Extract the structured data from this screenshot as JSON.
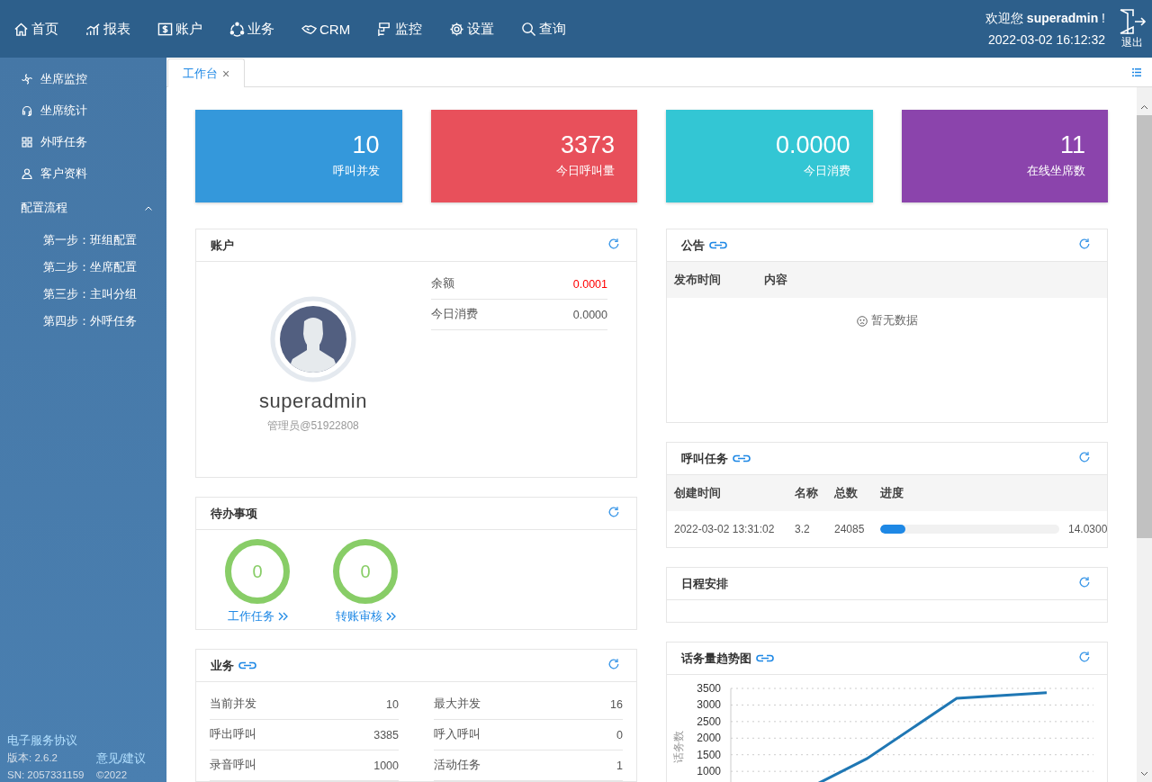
{
  "header": {
    "nav": [
      {
        "label": "首页"
      },
      {
        "label": "报表"
      },
      {
        "label": "账户"
      },
      {
        "label": "业务"
      },
      {
        "label": "CRM"
      },
      {
        "label": "监控"
      },
      {
        "label": "设置"
      },
      {
        "label": "查询"
      }
    ],
    "welcome": "欢迎您 **superadmin** !",
    "datetime": "2022-03-02 16:12:32",
    "logout": "退出"
  },
  "sidebar": {
    "items": [
      {
        "label": "坐席监控"
      },
      {
        "label": "坐席统计"
      },
      {
        "label": "外呼任务"
      },
      {
        "label": "客户资料"
      },
      {
        "label": "配置流程",
        "expanded": true,
        "children": [
          {
            "label": "第一步：班组配置"
          },
          {
            "label": "第二步：坐席配置"
          },
          {
            "label": "第三步：主叫分组"
          },
          {
            "label": "第四步：外呼任务"
          }
        ]
      }
    ],
    "footer": {
      "agreement_link": "电子服务协议",
      "version": "版本: 2.6.2",
      "feedback_link": "意见/建议",
      "sn": "SN: 2057331159",
      "copyright": "©2022"
    }
  },
  "tabs": [
    {
      "label": "工作台",
      "selected": true,
      "close": "×"
    }
  ],
  "stats": [
    {
      "value": "10",
      "label": "呼叫并发",
      "color": "#3498db"
    },
    {
      "value": "3373",
      "label": "今日呼叫量",
      "color": "#e8505b"
    },
    {
      "value": "0.0000",
      "label": "今日消费",
      "color": "#33c6d4"
    },
    {
      "value": "11",
      "label": "在线坐席数",
      "color": "#8b44ac"
    }
  ],
  "account": {
    "title": "账户",
    "linked": false,
    "name": "superadmin",
    "role": "管理员@51922808",
    "rows": [
      {
        "label": "余额",
        "value": "0.0001",
        "alert": true
      },
      {
        "label": "今日消费",
        "value": "0.0000",
        "alert": false
      }
    ]
  },
  "todo": {
    "title": "待办事项",
    "linked": false,
    "items": [
      {
        "count": "0",
        "label": "工作任务"
      },
      {
        "count": "0",
        "label": "转账审核"
      }
    ]
  },
  "business": {
    "title": "业务",
    "linked": true,
    "rows": [
      {
        "label": "当前并发",
        "value": "10"
      },
      {
        "label": "最大并发",
        "value": "16"
      },
      {
        "label": "呼出呼叫",
        "value": "3385"
      },
      {
        "label": "呼入呼叫",
        "value": "0"
      },
      {
        "label": "录音呼叫",
        "value": "1000"
      },
      {
        "label": "活动任务",
        "value": "1"
      }
    ]
  },
  "notice": {
    "title": "公告",
    "linked": true,
    "columns": [
      "发布时间",
      "内容"
    ],
    "empty": "暂无数据"
  },
  "tasks": {
    "title": "呼叫任务",
    "linked": true,
    "columns": [
      "创建时间",
      "名称",
      "总数",
      "进度"
    ],
    "rows": [
      {
        "created": "2022-03-02 13:31:02",
        "name": "3.2",
        "total": "24085",
        "level": 0.14,
        "percent": "14.0300"
      }
    ]
  },
  "schedule": {
    "title": "日程安排",
    "linked": false
  },
  "trend": {
    "title": "话务量趋势图",
    "linked": true,
    "chart_data": {
      "type": "line",
      "ylabel": "话务数",
      "ylim": [
        0,
        3500
      ],
      "yticks": [
        1000,
        1500,
        2000,
        2500,
        3000,
        3500
      ],
      "grid": true,
      "series": [
        {
          "color": "#1f77b4",
          "values": [
            0,
            1380,
            3200,
            3370
          ]
        }
      ]
    }
  }
}
